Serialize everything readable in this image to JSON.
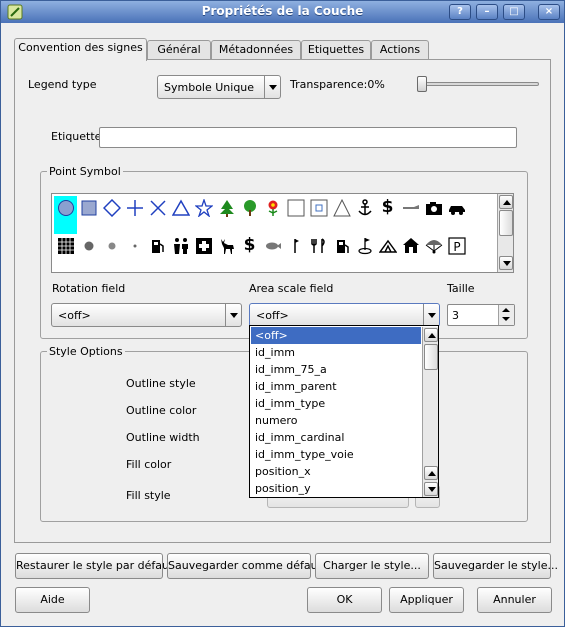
{
  "window": {
    "title": "Propriétés de la Couche",
    "controls": [
      "?",
      "–",
      "□",
      "×"
    ]
  },
  "tabs": [
    {
      "label": "Convention des signes",
      "active": true
    },
    {
      "label": "Général"
    },
    {
      "label": "Métadonnées"
    },
    {
      "label": "Etiquettes"
    },
    {
      "label": "Actions"
    }
  ],
  "legend": {
    "label": "Legend type",
    "value": "Symbole Unique"
  },
  "transparency": {
    "label": "Transparence:0%",
    "value_percent": 0
  },
  "etiquette": {
    "label": "Etiquette",
    "value": ""
  },
  "point_symbol": {
    "title": "Point Symbol"
  },
  "rotation": {
    "label": "Rotation field",
    "value": "<off>"
  },
  "area_scale": {
    "label": "Area scale field",
    "value": "<off>",
    "options": [
      "<off>",
      "id_imm",
      "id_imm_75_a",
      "id_imm_parent",
      "id_imm_type",
      "numero",
      "id_imm_cardinal",
      "id_imm_type_voie",
      "position_x",
      "position_y"
    ],
    "selected_index": 0
  },
  "taille": {
    "label": "Taille",
    "value": "3"
  },
  "style_options": {
    "title": "Style Options",
    "outline_style": "Outline style",
    "outline_color": "Outline color",
    "outline_width": "Outline width",
    "fill_color": "Fill color",
    "fill_style": "Fill style"
  },
  "buttons": {
    "restore_default": "Restaurer le style par défaut",
    "save_default": "Sauvegarder comme défaut",
    "load_style": "Charger le style...",
    "save_style": "Sauvegarder le style...",
    "help": "Aide",
    "ok": "OK",
    "apply": "Appliquer",
    "cancel": "Annuler"
  },
  "colors": {
    "selection": "#3e6cc2",
    "symbol_highlight": "#00ffff",
    "titlebar": "#4a72b8"
  }
}
